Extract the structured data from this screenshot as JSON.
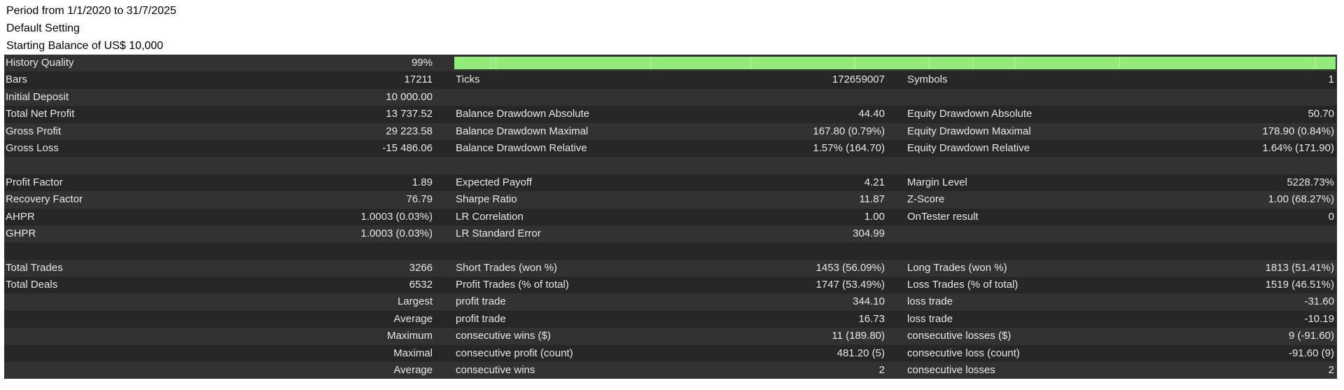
{
  "header": {
    "period": "Period from 1/1/2020 to 31/7/2025",
    "setting": "Default Setting",
    "balance": "Starting Balance of US$ 10,000"
  },
  "history_quality": {
    "label": "History Quality",
    "value": "99%",
    "bar_color": "#93ec79"
  },
  "rows": [
    {
      "l1": "Bars",
      "v1": "17211",
      "l2": "Ticks",
      "v2": "172659007",
      "l3": "Symbols",
      "v3": "1"
    },
    {
      "l1": "Initial Deposit",
      "v1": "10 000.00",
      "l2": "",
      "v2": "",
      "l3": "",
      "v3": ""
    },
    {
      "l1": "Total Net Profit",
      "v1": "13 737.52",
      "l2": "Balance Drawdown Absolute",
      "v2": "44.40",
      "l3": "Equity Drawdown Absolute",
      "v3": "50.70"
    },
    {
      "l1": "Gross Profit",
      "v1": "29 223.58",
      "l2": "Balance Drawdown Maximal",
      "v2": "167.80 (0.79%)",
      "l3": "Equity Drawdown Maximal",
      "v3": "178.90 (0.84%)"
    },
    {
      "l1": "Gross Loss",
      "v1": "-15 486.06",
      "l2": "Balance Drawdown Relative",
      "v2": "1.57% (164.70)",
      "l3": "Equity Drawdown Relative",
      "v3": "1.64% (171.90)"
    },
    {
      "l1": "",
      "v1": "",
      "l2": "",
      "v2": "",
      "l3": "",
      "v3": ""
    },
    {
      "l1": "Profit Factor",
      "v1": "1.89",
      "l2": "Expected Payoff",
      "v2": "4.21",
      "l3": "Margin Level",
      "v3": "5228.73%"
    },
    {
      "l1": "Recovery Factor",
      "v1": "76.79",
      "l2": "Sharpe Ratio",
      "v2": "11.87",
      "l3": "Z-Score",
      "v3": "1.00 (68.27%)"
    },
    {
      "l1": "AHPR",
      "v1": "1.0003 (0.03%)",
      "l2": "LR Correlation",
      "v2": "1.00",
      "l3": "OnTester result",
      "v3": "0"
    },
    {
      "l1": "GHPR",
      "v1": "1.0003 (0.03%)",
      "l2": "LR Standard Error",
      "v2": "304.99",
      "l3": "",
      "v3": ""
    },
    {
      "l1": "",
      "v1": "",
      "l2": "",
      "v2": "",
      "l3": "",
      "v3": ""
    },
    {
      "l1": "Total Trades",
      "v1": "3266",
      "l2": "Short Trades (won %)",
      "v2": "1453 (56.09%)",
      "l3": "Long Trades (won %)",
      "v3": "1813 (51.41%)"
    },
    {
      "l1": "Total Deals",
      "v1": "6532",
      "l2": "Profit Trades (% of total)",
      "v2": "1747 (53.49%)",
      "l3": "Loss Trades (% of total)",
      "v3": "1519 (46.51%)"
    },
    {
      "l1": "",
      "v1": "Largest",
      "l2": "profit trade",
      "v2": "344.10",
      "l3": "loss trade",
      "v3": "-31.60"
    },
    {
      "l1": "",
      "v1": "Average",
      "l2": "profit trade",
      "v2": "16.73",
      "l3": "loss trade",
      "v3": "-10.19"
    },
    {
      "l1": "",
      "v1": "Maximum",
      "l2": "consecutive wins ($)",
      "v2": "11 (189.80)",
      "l3": "consecutive losses ($)",
      "v3": "9 (-91.60)"
    },
    {
      "l1": "",
      "v1": "Maximal",
      "l2": "consecutive profit (count)",
      "v2": "481.20 (5)",
      "l3": "consecutive loss (count)",
      "v3": "-91.60 (9)"
    },
    {
      "l1": "",
      "v1": "Average",
      "l2": "consecutive wins",
      "v2": "2",
      "l3": "consecutive losses",
      "v3": "2"
    }
  ]
}
